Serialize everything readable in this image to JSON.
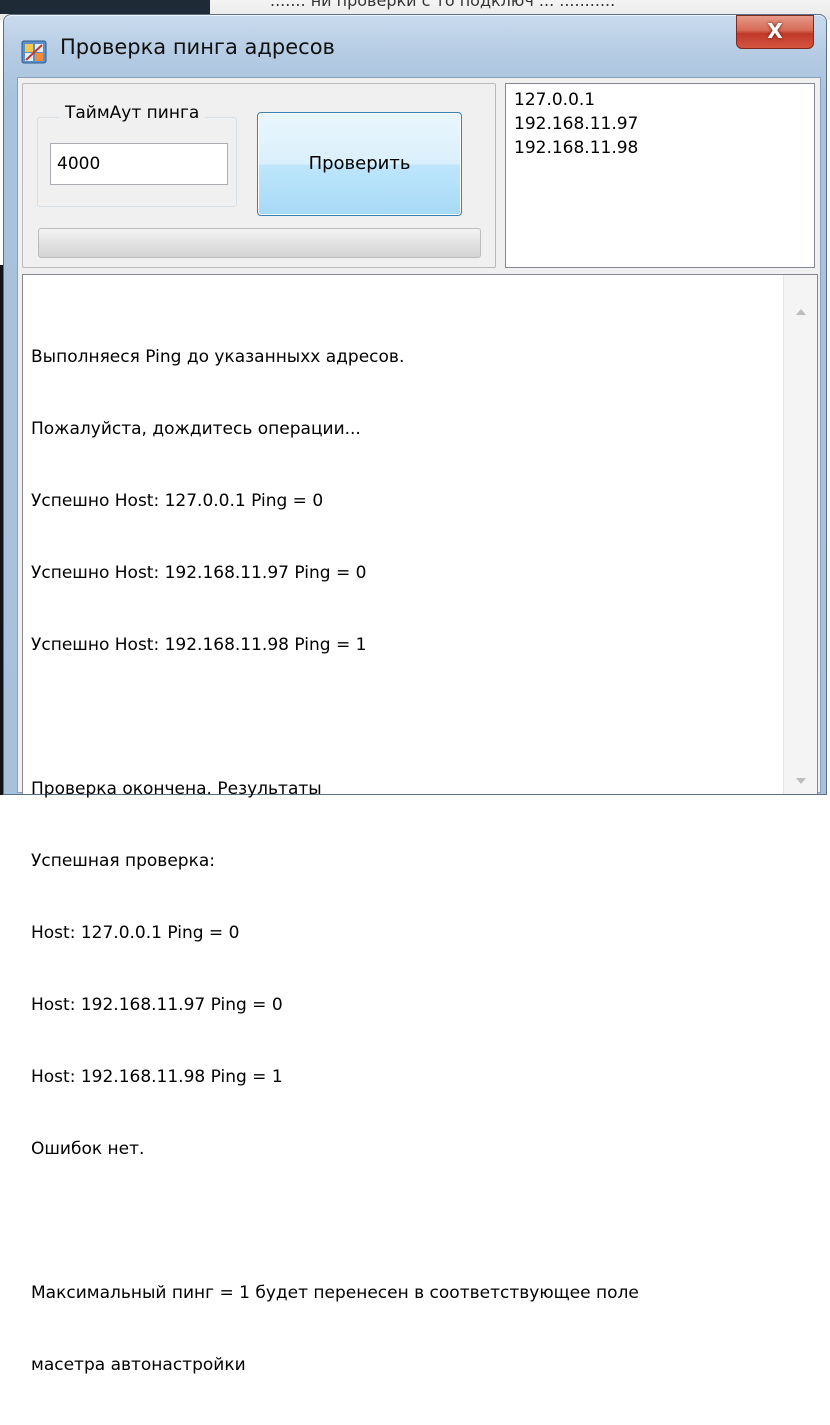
{
  "background_snippet": "....... ни проверки с то подключ ... ...........",
  "window": {
    "title": "Проверка пинга адресов",
    "close_label": "X"
  },
  "controls": {
    "timeout_group_label": "ТаймАут пинга",
    "timeout_value": "4000",
    "check_button_label": "Проверить",
    "progress_percent": 0
  },
  "addresses": [
    "127.0.0.1",
    "192.168.11.97",
    "192.168.11.98"
  ],
  "log": {
    "lines": [
      "Выполняеся Ping до указанныхх адресов.",
      "Пожалуйста, дождитесь операции...",
      "Успешно Host: 127.0.0.1 Ping = 0",
      "Успешно Host: 192.168.11.97 Ping = 0",
      "Успешно Host: 192.168.11.98 Ping = 1",
      "",
      "Проверка окончена. Результаты",
      "Успешная проверка:",
      "Host: 127.0.0.1 Ping = 0",
      "Host: 192.168.11.97 Ping = 0",
      "Host: 192.168.11.98 Ping = 1",
      "Ошибок нет.",
      "",
      "Максимальный пинг = 1 будет перенесен в соответствующее поле",
      "масетра автонастройки"
    ]
  },
  "icons": {
    "app": "tools-app-icon",
    "scroll_up": "scroll-up-arrow-icon",
    "scroll_down": "scroll-down-arrow-icon"
  },
  "colors": {
    "progress_fill": "#06b025",
    "close_button": "#c0392b",
    "button_border": "#3c7fb1"
  }
}
